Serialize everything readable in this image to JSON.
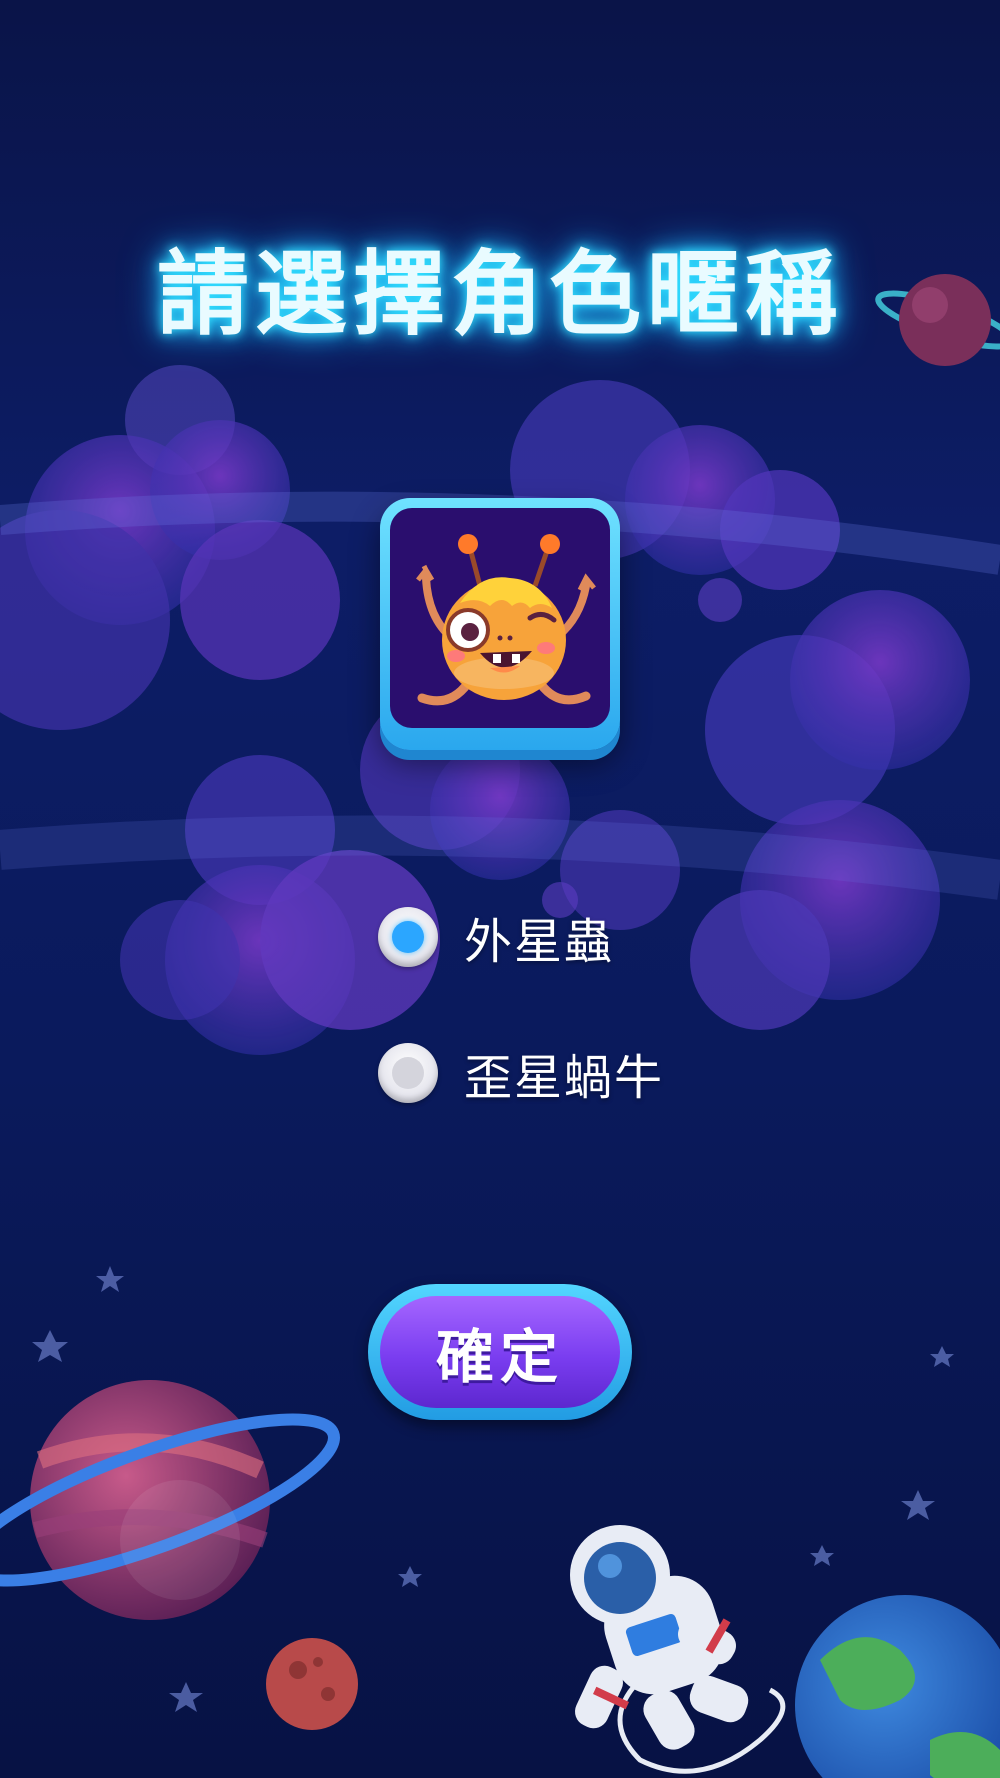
{
  "title": "請選擇角色暱稱",
  "avatar": {
    "icon": "alien-monster-icon"
  },
  "options": [
    {
      "label": "外星蟲",
      "selected": true
    },
    {
      "label": "歪星蝸牛",
      "selected": false
    }
  ],
  "confirm_button": {
    "label": "確定"
  },
  "colors": {
    "background": "#0d1d66",
    "title_glow": "#35e3ff",
    "radio_selected": "#2ba6ff",
    "button_purple": "#7a3df0",
    "button_rim": "#2aa7ee"
  }
}
